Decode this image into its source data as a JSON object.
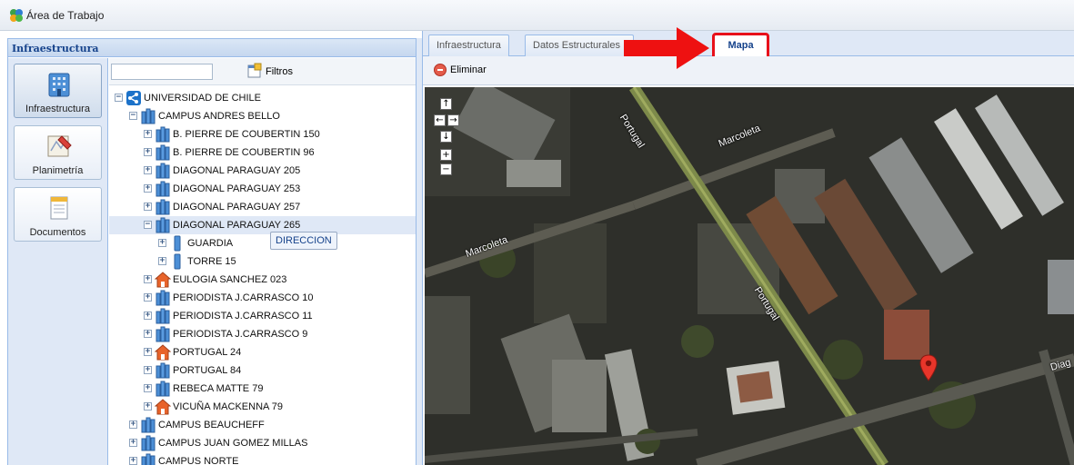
{
  "app": {
    "title": "Área de Trabajo",
    "logo_icon": "workspace-logo-icon"
  },
  "left_panel": {
    "title": "Infraestructura",
    "nav": [
      {
        "label": "Infraestructura",
        "icon": "building-icon",
        "active": true
      },
      {
        "label": "Planimetría",
        "icon": "blueprint-icon",
        "active": false
      },
      {
        "label": "Documentos",
        "icon": "document-icon",
        "active": false
      }
    ],
    "search": {
      "value": "",
      "placeholder": ""
    },
    "filters_label": "Filtros",
    "tree": [
      {
        "label": "UNIVERSIDAD DE CHILE",
        "level": 0,
        "toggle": "−",
        "icon": "share-icon"
      },
      {
        "label": "CAMPUS ANDRES BELLO",
        "level": 1,
        "toggle": "−",
        "icon": "campus-icon"
      },
      {
        "label": "B. PIERRE DE COUBERTIN 150",
        "level": 2,
        "toggle": "+",
        "icon": "building-icon"
      },
      {
        "label": "B. PIERRE DE COUBERTIN 96",
        "level": 2,
        "toggle": "+",
        "icon": "building-icon"
      },
      {
        "label": "DIAGONAL PARAGUAY 205",
        "level": 2,
        "toggle": "+",
        "icon": "building-icon"
      },
      {
        "label": "DIAGONAL PARAGUAY 253",
        "level": 2,
        "toggle": "+",
        "icon": "building-icon"
      },
      {
        "label": "DIAGONAL PARAGUAY 257",
        "level": 2,
        "toggle": "+",
        "icon": "building-icon"
      },
      {
        "label": "DIAGONAL PARAGUAY 265",
        "level": 2,
        "toggle": "−",
        "icon": "building-icon",
        "selected": true
      },
      {
        "label": "GUARDIA",
        "level": 3,
        "toggle": "+",
        "icon": "tower-icon"
      },
      {
        "label": "TORRE 15",
        "level": 3,
        "toggle": "+",
        "icon": "tower-icon"
      },
      {
        "label": "EULOGIA SANCHEZ 023",
        "level": 2,
        "toggle": "+",
        "icon": "house-icon"
      },
      {
        "label": "PERIODISTA J.CARRASCO 10",
        "level": 2,
        "toggle": "+",
        "icon": "building-icon"
      },
      {
        "label": "PERIODISTA J.CARRASCO 11",
        "level": 2,
        "toggle": "+",
        "icon": "building-icon"
      },
      {
        "label": "PERIODISTA J.CARRASCO 9",
        "level": 2,
        "toggle": "+",
        "icon": "building-icon"
      },
      {
        "label": "PORTUGAL 24",
        "level": 2,
        "toggle": "+",
        "icon": "house-icon"
      },
      {
        "label": "PORTUGAL 84",
        "level": 2,
        "toggle": "+",
        "icon": "building-icon"
      },
      {
        "label": "REBECA MATTE 79",
        "level": 2,
        "toggle": "+",
        "icon": "building-icon"
      },
      {
        "label": "VICUÑA MACKENNA 79",
        "level": 2,
        "toggle": "+",
        "icon": "house-icon"
      },
      {
        "label": "CAMPUS BEAUCHEFF",
        "level": 1,
        "toggle": "+",
        "icon": "campus-icon"
      },
      {
        "label": "CAMPUS JUAN GOMEZ MILLAS",
        "level": 1,
        "toggle": "+",
        "icon": "campus-icon"
      },
      {
        "label": "CAMPUS NORTE",
        "level": 1,
        "toggle": "+",
        "icon": "campus-icon"
      }
    ],
    "tooltip": "DIRECCION"
  },
  "right_panel": {
    "tabs": [
      {
        "label": "Infraestructura",
        "active": false
      },
      {
        "label": "Datos Estructurales",
        "active": false
      },
      {
        "label": "Mapa",
        "active": true,
        "highlighted": true
      }
    ],
    "toolbar": {
      "delete_label": "Eliminar"
    },
    "map": {
      "controls": [
        "↑",
        "←",
        "→",
        "↓",
        "+",
        "−"
      ],
      "street_labels": [
        "Portugal",
        "Marcoleta",
        "Marcoleta",
        "Portugal",
        "Diag"
      ],
      "marker_icon": "map-pin-icon"
    }
  },
  "colors": {
    "accent": "#15428b",
    "border": "#99bbe8",
    "highlight": "#e8101a",
    "map_bg": "#2b2c28"
  }
}
